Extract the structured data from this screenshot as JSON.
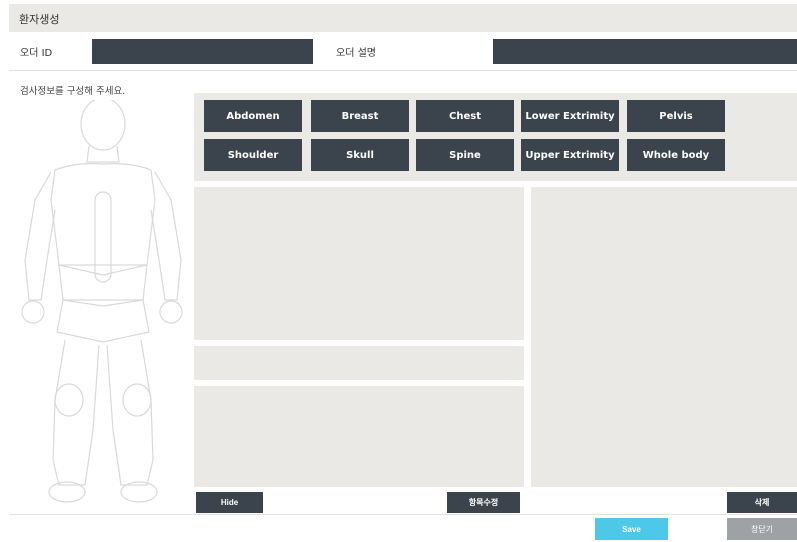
{
  "header": {
    "title": "환자생성"
  },
  "order": {
    "id_label": "오더 ID",
    "id_value": "",
    "desc_label": "오더 설명",
    "desc_value": ""
  },
  "instruction": "검사정보를 구성해 주세요.",
  "regions": {
    "row1": [
      "Abdomen",
      "Breast",
      "Chest",
      "Lower Extrimity",
      "Pelvis"
    ],
    "row2": [
      "Shoulder",
      "Skull",
      "Spine",
      "Upper Extrimity",
      "Whole body"
    ]
  },
  "buttons": {
    "hide": "Hide",
    "edit_items": "항목수정",
    "delete": "삭제",
    "save": "Save",
    "close": "창닫기"
  }
}
